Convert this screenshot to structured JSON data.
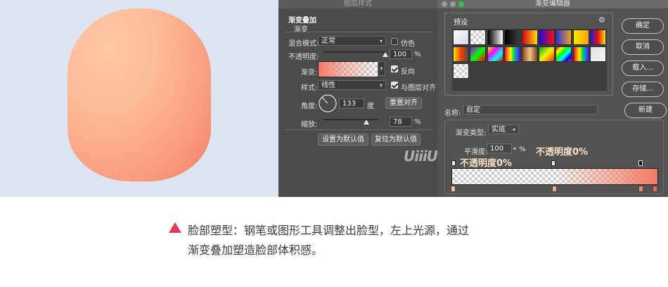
{
  "layer_style": {
    "window_title": "图层样式",
    "section_title": "渐变叠加",
    "group_title": "渐变",
    "blend_mode_label": "混合模式:",
    "blend_mode_value": "正常",
    "dither_label": "仿色",
    "dither_checked": false,
    "opacity_label": "不透明度:",
    "opacity_value": "100",
    "opacity_unit": "%",
    "opacity_level": 1.0,
    "gradient_label": "渐变:",
    "reverse_label": "反向",
    "reverse_checked": true,
    "style_label": "样式:",
    "style_value": "线性",
    "align_label": "与图层对齐",
    "align_checked": true,
    "angle_label": "角度:",
    "angle_value": "133",
    "angle_unit": "度",
    "angle_degrees": 133,
    "reset_align_label": "重置对齐",
    "scale_label": "缩放:",
    "scale_value": "78",
    "scale_unit": "%",
    "scale_level": 0.78,
    "make_default_label": "设置为默认值",
    "reset_default_label": "复位为默认值"
  },
  "gradient_editor": {
    "window_title": "渐变编辑器",
    "presets_label": "预设",
    "ok_label": "确定",
    "cancel_label": "取消",
    "load_label": "载入...",
    "save_label": "存储...",
    "new_label": "新建",
    "name_label": "名称:",
    "name_value": "自定",
    "type_label": "渐变类型:",
    "type_value": "实底",
    "smoothness_label": "平滑度:",
    "smoothness_value": "100",
    "smoothness_unit": "%",
    "callout_left": "不透明度0%",
    "callout_right": "不透明度0%"
  },
  "colors": {
    "face_light": "#ffc8a6",
    "face_dark": "#f28066",
    "gradient_end": "#f27a63",
    "accent_marker": "#e23a56"
  },
  "watermark": "UiiiUiii",
  "caption": {
    "line1": "脸部塑型：钢笔或图形工具调整出脸型，左上光源，通过",
    "line2": "渐变叠加塑造脸部体积感。"
  }
}
